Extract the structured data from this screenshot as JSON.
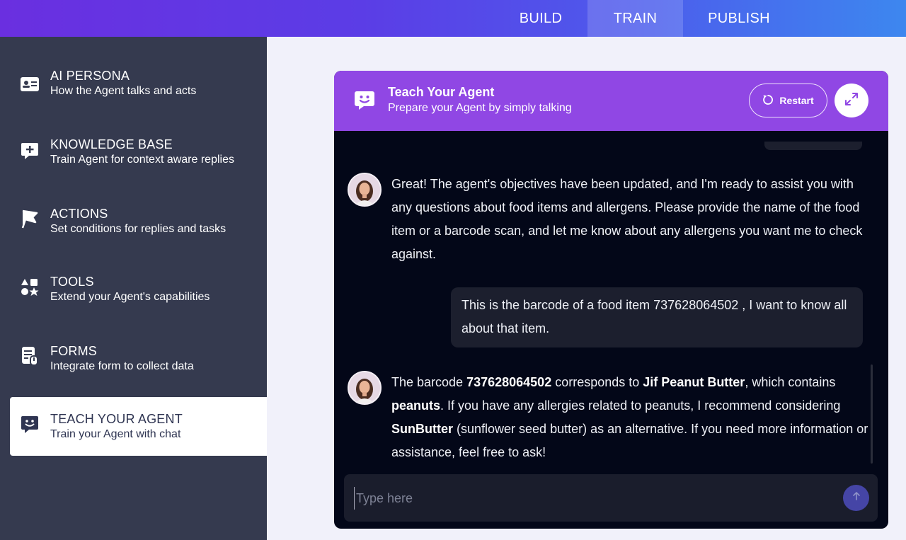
{
  "topnav": {
    "tabs": [
      {
        "label": "BUILD"
      },
      {
        "label": "TRAIN"
      },
      {
        "label": "PUBLISH"
      }
    ],
    "active": "TRAIN"
  },
  "sidebar": {
    "items": [
      {
        "title": "AI PERSONA",
        "subtitle": "How the Agent talks and acts",
        "icon": "id-card-icon"
      },
      {
        "title": "KNOWLEDGE BASE",
        "subtitle": "Train Agent for context aware replies",
        "icon": "chat-plus-icon"
      },
      {
        "title": "ACTIONS",
        "subtitle": "Set conditions for replies and tasks",
        "icon": "flag-icon"
      },
      {
        "title": "TOOLS",
        "subtitle": "Extend your Agent's capabilities",
        "icon": "shapes-icon"
      },
      {
        "title": "FORMS",
        "subtitle": "Integrate form to collect data",
        "icon": "form-icon"
      },
      {
        "title": "TEACH YOUR AGENT",
        "subtitle": "Train your Agent with chat",
        "icon": "chat-smile-icon",
        "active": true
      }
    ]
  },
  "panel": {
    "title": "Teach Your Agent",
    "subtitle": "Prepare your Agent by simply talking",
    "restart_label": "Restart",
    "messages": {
      "bot1": "Great! The agent's objectives have been updated, and I'm ready to assist you with any questions about food items and allergens. Please provide the name of the food item or a barcode scan, and let me know about any allergens you want me to check against.",
      "user1": "This is the barcode of a food item 737628064502 , I want to know all about that item.",
      "bot2": {
        "t1": "The barcode ",
        "b1": "737628064502",
        "t2": " corresponds to ",
        "b2": "Jif Peanut Butter",
        "t3": ", which contains ",
        "b3": "peanuts",
        "t4": ". If you have any allergies related to peanuts, I recommend considering ",
        "b4": "SunButter",
        "t5": " (sunflower seed butter) as an alternative. If you need more information or assistance, feel free to ask!"
      }
    },
    "input_placeholder": "Type here"
  },
  "colors": {
    "header_gradient_start": "#6a2fe0",
    "header_gradient_end": "#3d87ef",
    "sidebar_bg": "#353a4f",
    "panel_header": "#9047e4",
    "chat_bg": "#030718"
  }
}
